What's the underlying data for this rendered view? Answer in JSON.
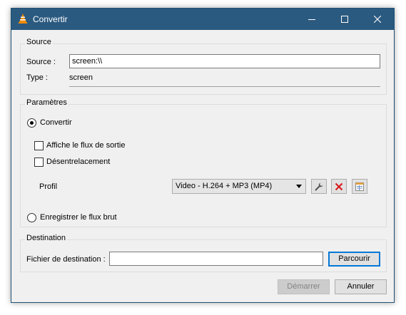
{
  "window": {
    "title": "Convertir"
  },
  "source": {
    "group_title": "Source",
    "source_label": "Source :",
    "source_value": "screen:\\\\",
    "type_label": "Type :",
    "type_value": "screen"
  },
  "settings": {
    "group_title": "Paramètres",
    "convert_label": "Convertir",
    "convert_selected": true,
    "show_output_label": "Affiche le flux de sortie",
    "show_output_checked": false,
    "deinterlace_label": "Désentrelacement",
    "deinterlace_checked": false,
    "profile_label": "Profil",
    "profile_value": "Video - H.264 + MP3 (MP4)",
    "dump_raw_label": "Enregistrer le flux brut",
    "dump_raw_selected": false
  },
  "destination": {
    "group_title": "Destination",
    "file_label": "Fichier de destination :",
    "file_value": "",
    "browse_label": "Parcourir"
  },
  "buttons": {
    "start_label": "Démarrer",
    "start_disabled": true,
    "cancel_label": "Annuler"
  },
  "colors": {
    "titlebar": "#2b5a80",
    "dialog_bg": "#f0f0f0",
    "delete_icon": "#d9191c"
  }
}
